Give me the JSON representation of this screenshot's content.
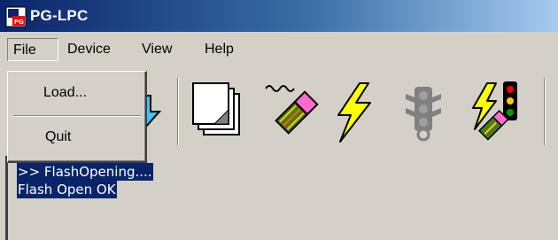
{
  "window": {
    "title": "PG-LPC"
  },
  "menu": {
    "file": "File",
    "device": "Device",
    "view": "View",
    "help": "Help"
  },
  "file_menu": {
    "load": "Load...",
    "quit": "Quit"
  },
  "toolbar": {
    "buttons": [
      {
        "icon": "download-arrow-icon"
      },
      {
        "icon": "blank-pages-icon"
      },
      {
        "icon": "erase-chip-icon"
      },
      {
        "icon": "lightning-program-icon"
      },
      {
        "icon": "traffic-light-disabled-icon"
      },
      {
        "icon": "lightning-traffic-light-icon"
      }
    ]
  },
  "output": {
    "lines": [
      ">> FlashOpening....",
      "Flash Open OK"
    ]
  },
  "colors": {
    "title_gradient_start": "#0a246a",
    "title_gradient_end": "#a6caf0",
    "face": "#d4d0c8",
    "selection": "#0a246a",
    "lightning": "#ffff00"
  }
}
